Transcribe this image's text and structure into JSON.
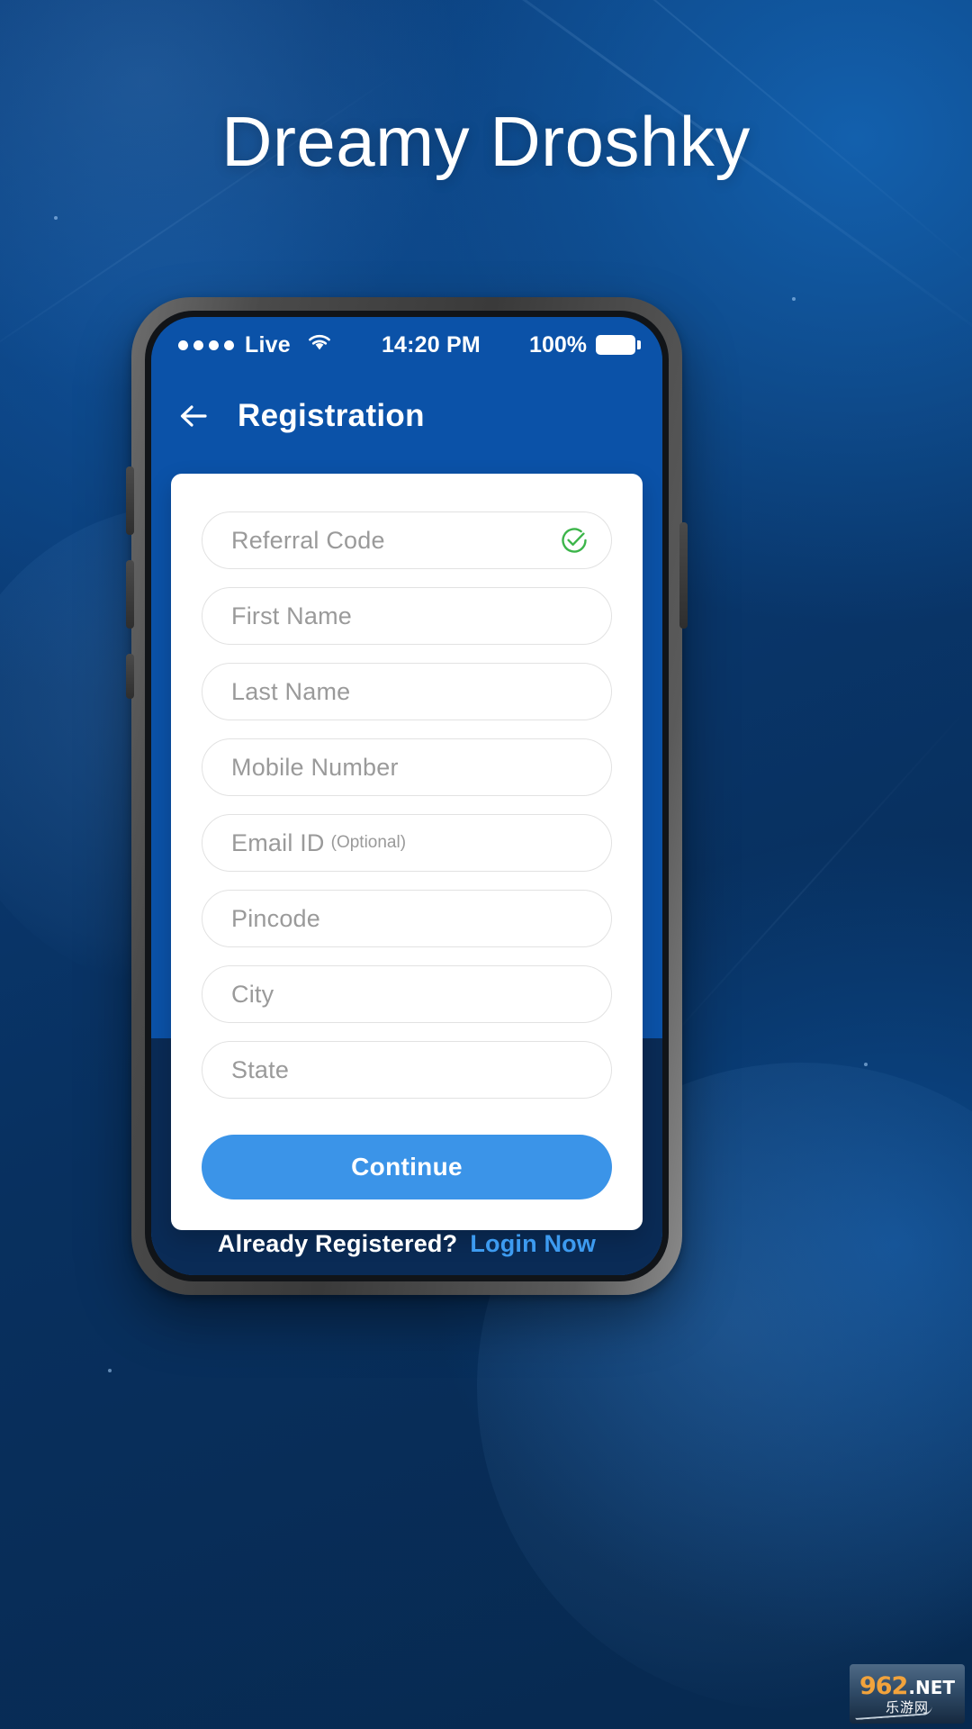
{
  "poster": {
    "title": "Dreamy Droshky",
    "background_color": "#0a3a72",
    "accent_color": "#0b52a8"
  },
  "phone": {
    "status_bar": {
      "signal_dots": 4,
      "carrier": "Live",
      "wifi_icon": "wifi-icon",
      "time": "14:20 PM",
      "battery_percent": "100%",
      "battery_icon": "battery-full-icon"
    },
    "app_bar": {
      "back_icon": "arrow-left-icon",
      "title": "Registration"
    },
    "form": {
      "fields": [
        {
          "name": "referral-code",
          "placeholder": "Referral Code",
          "suffix": "",
          "verified": true,
          "check_icon": "check-circle-icon",
          "check_color": "#3cb54a"
        },
        {
          "name": "first-name",
          "placeholder": "First Name",
          "suffix": "",
          "verified": false
        },
        {
          "name": "last-name",
          "placeholder": "Last Name",
          "suffix": "",
          "verified": false
        },
        {
          "name": "mobile-number",
          "placeholder": "Mobile Number",
          "suffix": "",
          "verified": false
        },
        {
          "name": "email-id",
          "placeholder": "Email ID",
          "suffix": "(Optional)",
          "verified": false
        },
        {
          "name": "pincode",
          "placeholder": "Pincode",
          "suffix": "",
          "verified": false
        },
        {
          "name": "city",
          "placeholder": "City",
          "suffix": "",
          "verified": false
        },
        {
          "name": "state",
          "placeholder": "State",
          "suffix": "",
          "verified": false
        }
      ],
      "submit_label": "Continue",
      "submit_color": "#3b94e8"
    },
    "footer": {
      "text": "Already Registered?",
      "link_label": "Login Now",
      "link_color": "#3d9bf0"
    }
  },
  "watermark": {
    "number": "962",
    "domain": ".NET",
    "subtitle": "乐游网"
  }
}
